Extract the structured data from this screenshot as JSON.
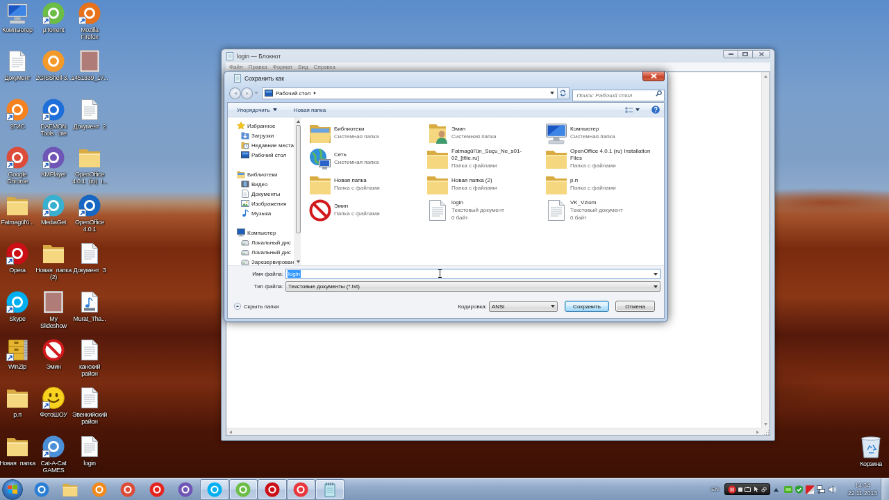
{
  "desktop": {
    "icons": [
      {
        "label": "Компьютер",
        "kind": "monitor",
        "shortcut": false
      },
      {
        "label": "Документ",
        "kind": "document",
        "shortcut": false
      },
      {
        "label": "2ГИС",
        "kind": "app",
        "color": "#f5821f",
        "shortcut": true
      },
      {
        "label": "Google Chrome",
        "kind": "app",
        "color": "#dd4b39",
        "shortcut": true
      },
      {
        "label": "Fatmagül'ü...",
        "kind": "folder",
        "shortcut": false
      },
      {
        "label": "Opera",
        "kind": "app",
        "color": "#cc0f16",
        "shortcut": true
      },
      {
        "label": "Skype",
        "kind": "app",
        "color": "#00aff0",
        "shortcut": true
      },
      {
        "label": "WinZip",
        "kind": "archive",
        "shortcut": true
      },
      {
        "label": "р.п",
        "kind": "folder",
        "shortcut": false
      },
      {
        "label": "Новая папка",
        "kind": "folder",
        "shortcut": false
      },
      {
        "label": "µTorrent",
        "kind": "app",
        "color": "#6bbd45",
        "shortcut": true
      },
      {
        "label": "2GISShell-3...",
        "kind": "app",
        "color": "#f39a2b",
        "shortcut": false
      },
      {
        "label": "DAEMON Tools Lite",
        "kind": "app",
        "color": "#1e6fd9",
        "shortcut": true
      },
      {
        "label": "KMPlayer",
        "kind": "app",
        "color": "#6f55b5",
        "shortcut": true
      },
      {
        "label": "MediaGet",
        "kind": "app",
        "color": "#3ab0d0",
        "shortcut": true
      },
      {
        "label": "Новая папка (2)",
        "kind": "folder",
        "shortcut": false
      },
      {
        "label": "My Slideshow",
        "kind": "photo",
        "shortcut": false
      },
      {
        "label": "Эмин",
        "kind": "blocked",
        "shortcut": false
      },
      {
        "label": "ФотоШОУ",
        "kind": "smiley",
        "shortcut": true
      },
      {
        "label": "Cat-A-Cat GAMES",
        "kind": "app",
        "color": "#4a8fd8",
        "shortcut": true
      },
      {
        "label": "Mozilla Firefox",
        "kind": "app",
        "color": "#e8711c",
        "shortcut": true
      },
      {
        "label": "1451339_17...",
        "kind": "photo",
        "shortcut": false
      },
      {
        "label": "Документ 2",
        "kind": "document",
        "shortcut": false
      },
      {
        "label": "OpenOffice 4.0.1 (ru) I...",
        "kind": "folder",
        "shortcut": false
      },
      {
        "label": "OpenOffice 4.0.1",
        "kind": "app",
        "color": "#1767c2",
        "shortcut": true
      },
      {
        "label": "Документ 3",
        "kind": "document",
        "shortcut": false
      },
      {
        "label": "Murat_Tha...",
        "kind": "audio",
        "shortcut": false
      },
      {
        "label": "канский район",
        "kind": "document",
        "shortcut": false
      },
      {
        "label": "Эвенкийский район",
        "kind": "document",
        "shortcut": false
      },
      {
        "label": "login",
        "kind": "document",
        "shortcut": false
      }
    ],
    "recycle_bin": {
      "label": "Корзина"
    }
  },
  "notepad": {
    "title": "login — Блокнот",
    "menu": [
      "Файл",
      "Правка",
      "Формат",
      "Вид",
      "Справка"
    ]
  },
  "dialog": {
    "title": "Сохранить как",
    "path": "Рабочий стол",
    "search_placeholder": "Поиск: Рабочий стол",
    "toolbar": {
      "organize": "Упорядочить",
      "new_folder": "Новая папка"
    },
    "nav": [
      {
        "label": "Избранное",
        "kind": "star",
        "children": [
          {
            "label": "Загрузки",
            "kind": "downloads"
          },
          {
            "label": "Недавние места",
            "kind": "recent"
          },
          {
            "label": "Рабочий стол",
            "kind": "desktop"
          }
        ]
      },
      {
        "label": "Библиотеки",
        "kind": "library",
        "children": [
          {
            "label": "Видео",
            "kind": "video"
          },
          {
            "label": "Документы",
            "kind": "documents"
          },
          {
            "label": "Изображения",
            "kind": "pictures"
          },
          {
            "label": "Музыка",
            "kind": "music"
          }
        ]
      },
      {
        "label": "Компьютер",
        "kind": "computer",
        "children": [
          {
            "label": "Локальный дис",
            "kind": "drive"
          },
          {
            "label": "Локальный дис",
            "kind": "drive"
          },
          {
            "label": "Зарезервирован",
            "kind": "drive"
          }
        ]
      }
    ],
    "files": [
      {
        "name": "Библиотеки",
        "type": "Системная папка",
        "kind": "library"
      },
      {
        "name": "Эмин",
        "type": "Системная папка",
        "kind": "user"
      },
      {
        "name": "Компьютер",
        "type": "Системная папка",
        "kind": "computer"
      },
      {
        "name": "Сеть",
        "type": "Системная папка",
        "kind": "network"
      },
      {
        "name": "Fatmagül'ün_Suçu_Ne_s01-02_[tfile.ru]",
        "type": "Папка с файлами",
        "kind": "folder"
      },
      {
        "name": "OpenOffice 4.0.1 (ru) Installation Files",
        "type": "Папка с файлами",
        "kind": "folder"
      },
      {
        "name": "Новая папка",
        "type": "Папка с файлами",
        "kind": "folder"
      },
      {
        "name": "Новая папка (2)",
        "type": "Папка с файлами",
        "kind": "folder"
      },
      {
        "name": "р.п",
        "type": "Папка с файлами",
        "kind": "folder"
      },
      {
        "name": "Эмин",
        "type": "Папка с файлами",
        "kind": "blocked"
      },
      {
        "name": "login",
        "type": "Текстовый документ",
        "size": "0 байт",
        "kind": "text"
      },
      {
        "name": "VK_Vzlom",
        "type": "Текстовый документ",
        "size": "0 байт",
        "kind": "text"
      }
    ],
    "file_name": {
      "label": "Имя файла:",
      "value": "login",
      "text_selected": true
    },
    "file_type": {
      "label": "Тип файла:",
      "value": "Текстовые документы (*.txt)"
    },
    "hide_folders": "Скрыть папки",
    "encoding": {
      "label": "Кодировка:",
      "value": "ANSI"
    },
    "buttons": [
      {
        "label": "Сохранить",
        "default": true
      },
      {
        "label": "Отмена",
        "default": false
      }
    ]
  },
  "taskbar": {
    "items": [
      {
        "kind": "app",
        "color": "#2a7fd4",
        "running": false
      },
      {
        "kind": "folder",
        "running": false
      },
      {
        "kind": "app",
        "color": "#f08a1d",
        "running": false
      },
      {
        "kind": "app",
        "color": "#dd4b39",
        "running": false
      },
      {
        "kind": "app",
        "color": "#e52620",
        "running": false
      },
      {
        "kind": "app",
        "color": "#6f55b5",
        "running": false
      },
      {
        "kind": "app",
        "color": "#00aff0",
        "running": true
      },
      {
        "kind": "app",
        "color": "#6bbd45",
        "running": true
      },
      {
        "kind": "app",
        "color": "#cc0f16",
        "running": true
      },
      {
        "kind": "app",
        "color": "#e8383d",
        "running": true
      },
      {
        "kind": "notepad",
        "running": true
      }
    ],
    "language": "EN",
    "clock": {
      "time": "14:34",
      "date": "22.11.2013"
    }
  }
}
